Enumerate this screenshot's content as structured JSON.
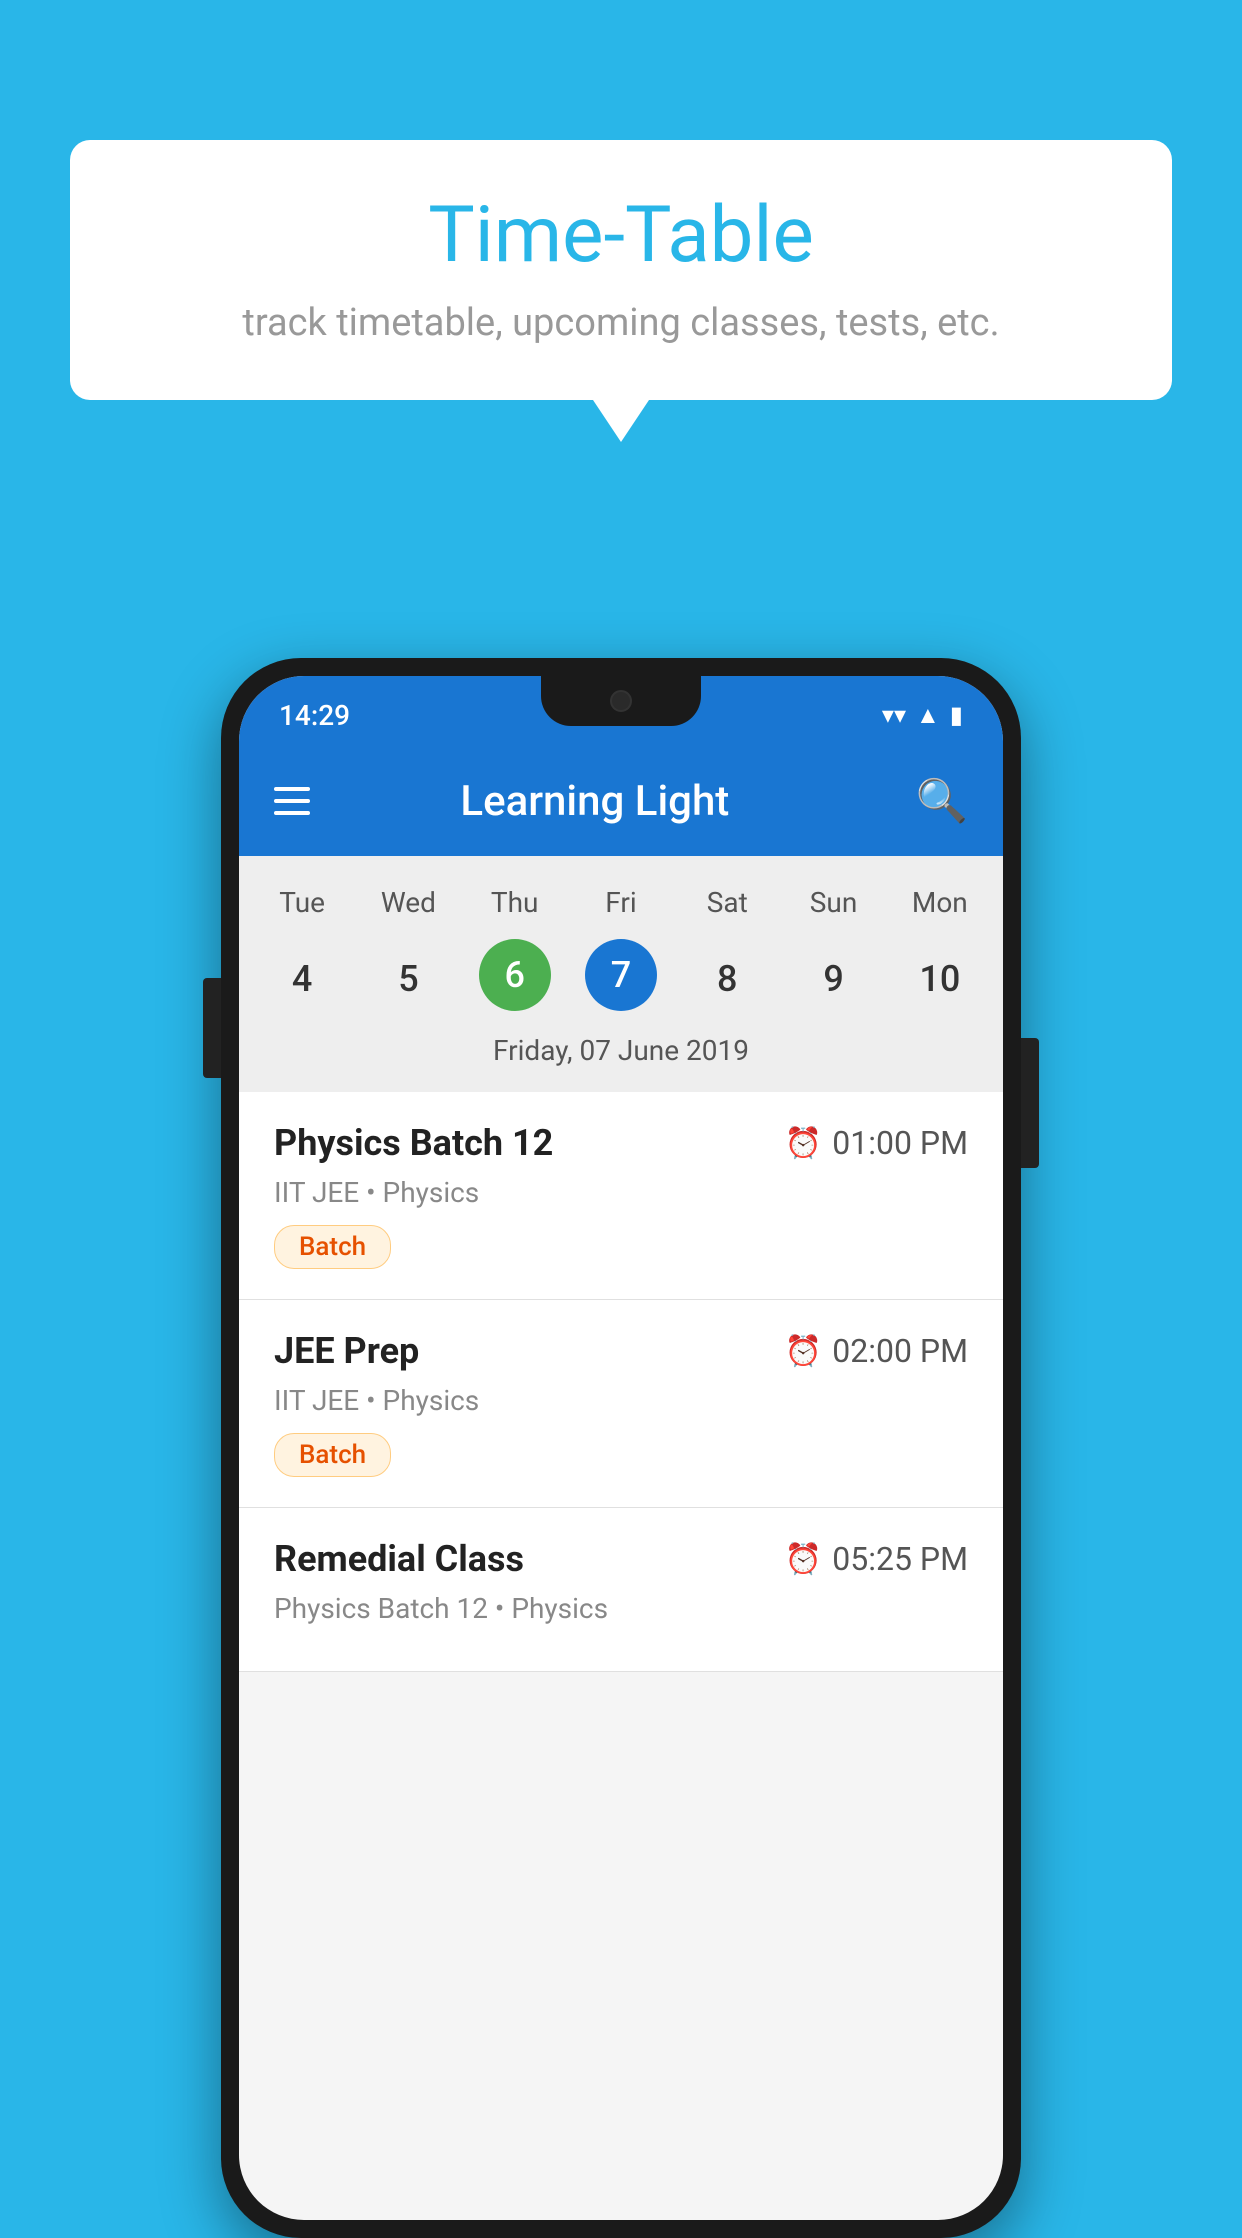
{
  "background_color": "#29B6E8",
  "tooltip": {
    "title": "Time-Table",
    "subtitle": "track timetable, upcoming classes, tests, etc."
  },
  "phone": {
    "status_bar": {
      "time": "14:29",
      "wifi_icon": "wifi",
      "signal_icon": "signal",
      "battery_icon": "battery"
    },
    "app_bar": {
      "title": "Learning Light",
      "menu_icon": "menu",
      "search_icon": "search"
    },
    "calendar": {
      "days": [
        "Tue",
        "Wed",
        "Thu",
        "Fri",
        "Sat",
        "Sun",
        "Mon"
      ],
      "dates": [
        "4",
        "5",
        "6",
        "7",
        "8",
        "9",
        "10"
      ],
      "today_index": 2,
      "selected_index": 3,
      "selected_label": "Friday, 07 June 2019"
    },
    "schedule": [
      {
        "title": "Physics Batch 12",
        "time": "01:00 PM",
        "subtitle": "IIT JEE • Physics",
        "badge": "Batch"
      },
      {
        "title": "JEE Prep",
        "time": "02:00 PM",
        "subtitle": "IIT JEE • Physics",
        "badge": "Batch"
      },
      {
        "title": "Remedial Class",
        "time": "05:25 PM",
        "subtitle": "Physics Batch 12 • Physics",
        "badge": null
      }
    ]
  }
}
